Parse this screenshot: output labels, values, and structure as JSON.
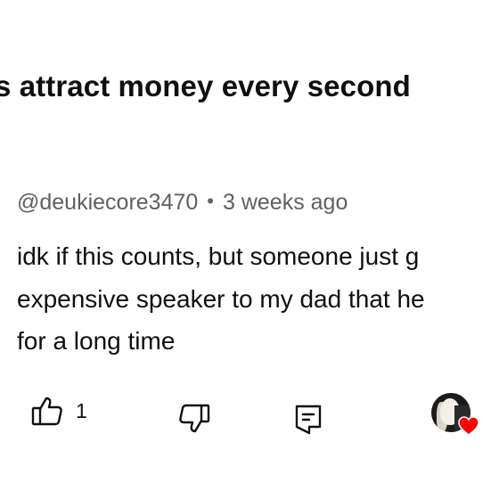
{
  "video": {
    "title": "s attract money every second"
  },
  "comment": {
    "author": "@deukiecore3470",
    "separator": "•",
    "timestamp": "3 weeks ago",
    "text_lines": [
      "idk if this counts, but someone just g",
      "expensive speaker to my dad that he",
      "for a long time"
    ],
    "like_count": "1"
  },
  "icons": {
    "like": "thumbs-up-icon",
    "dislike": "thumbs-down-icon",
    "reply": "reply-comment-icon",
    "creator_heart": "heart-icon"
  },
  "colors": {
    "text": "#0f0f0f",
    "meta": "#606060",
    "heart": "#ff0000"
  }
}
